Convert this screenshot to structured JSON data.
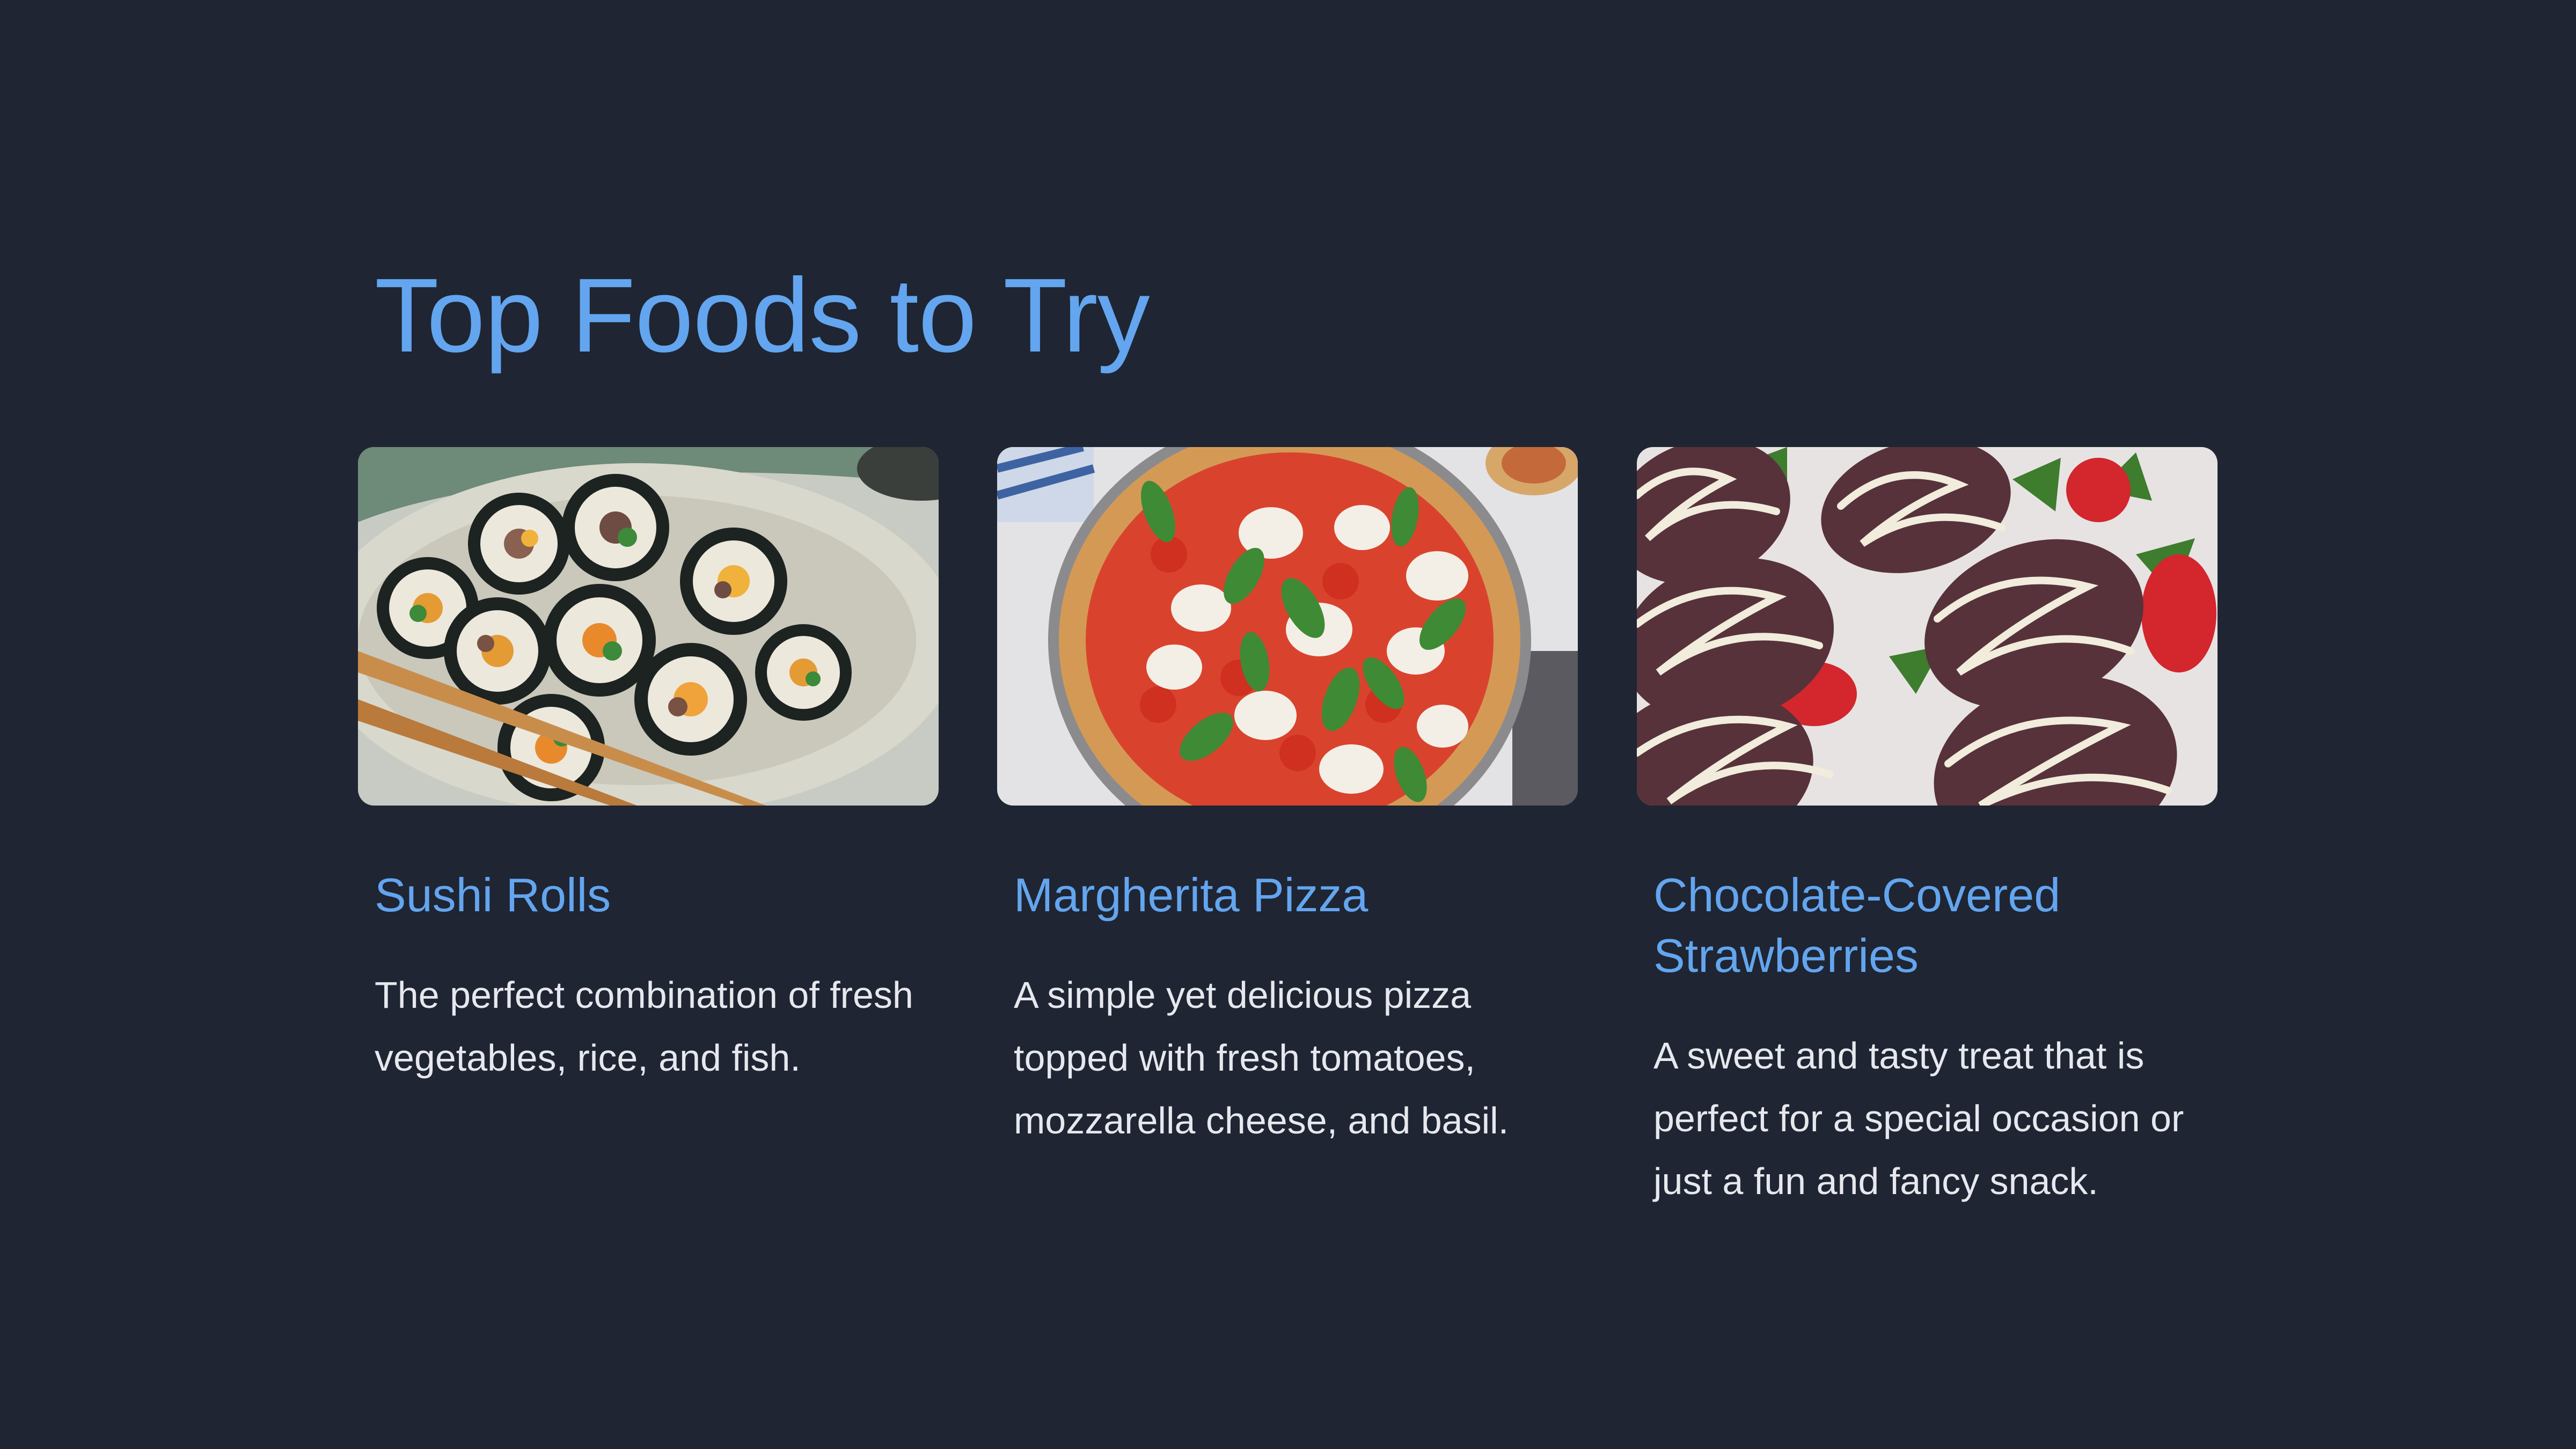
{
  "page": {
    "title": "Top Foods to Try",
    "colors": {
      "background": "#1f2532",
      "accent": "#63a5ef",
      "text": "#e6e8ee"
    }
  },
  "cards": [
    {
      "image": "sushi-rolls-photo",
      "title": "Sushi Rolls",
      "description": "The perfect combination of fresh vegetables, rice, and fish."
    },
    {
      "image": "margherita-pizza-photo",
      "title": "Margherita Pizza",
      "description": "A simple yet delicious pizza topped with fresh tomatoes, mozzarella cheese, and basil."
    },
    {
      "image": "chocolate-strawberries-photo",
      "title": "Chocolate-Covered Strawberries",
      "description": "A sweet and tasty treat that is perfect for a special occasion or just a fun and fancy snack."
    }
  ]
}
